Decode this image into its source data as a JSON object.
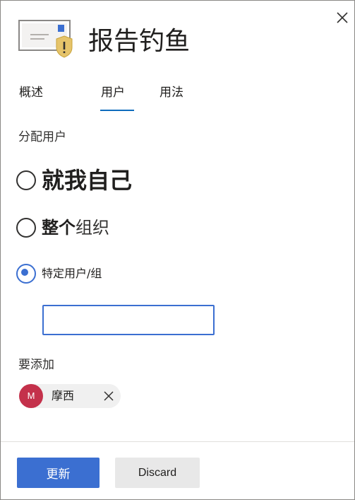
{
  "header": {
    "title": "报告钓鱼",
    "icon": "envelope-warning-icon",
    "close_icon": "close-icon"
  },
  "tabs": [
    {
      "label": "概述",
      "selected": false
    },
    {
      "label": "用户",
      "selected": true
    },
    {
      "label": "用法",
      "selected": false
    }
  ],
  "assign": {
    "section_label": "分配用户",
    "options": [
      {
        "label": "就我自己",
        "selected": false
      },
      {
        "label_bold": "整个",
        "label_normal": "组织",
        "selected": false
      },
      {
        "label": "特定用户/组",
        "selected": true
      }
    ],
    "input_value": "",
    "input_placeholder": ""
  },
  "to_add": {
    "label": "要添加",
    "chips": [
      {
        "initial": "M",
        "name": "摩西",
        "avatar_color": "#c4314b"
      }
    ]
  },
  "footer": {
    "primary_label": "更新",
    "secondary_label": "Discard"
  },
  "colors": {
    "accent": "#3b6fd1",
    "tab_underline": "#0f6cbd",
    "avatar": "#c4314b"
  }
}
